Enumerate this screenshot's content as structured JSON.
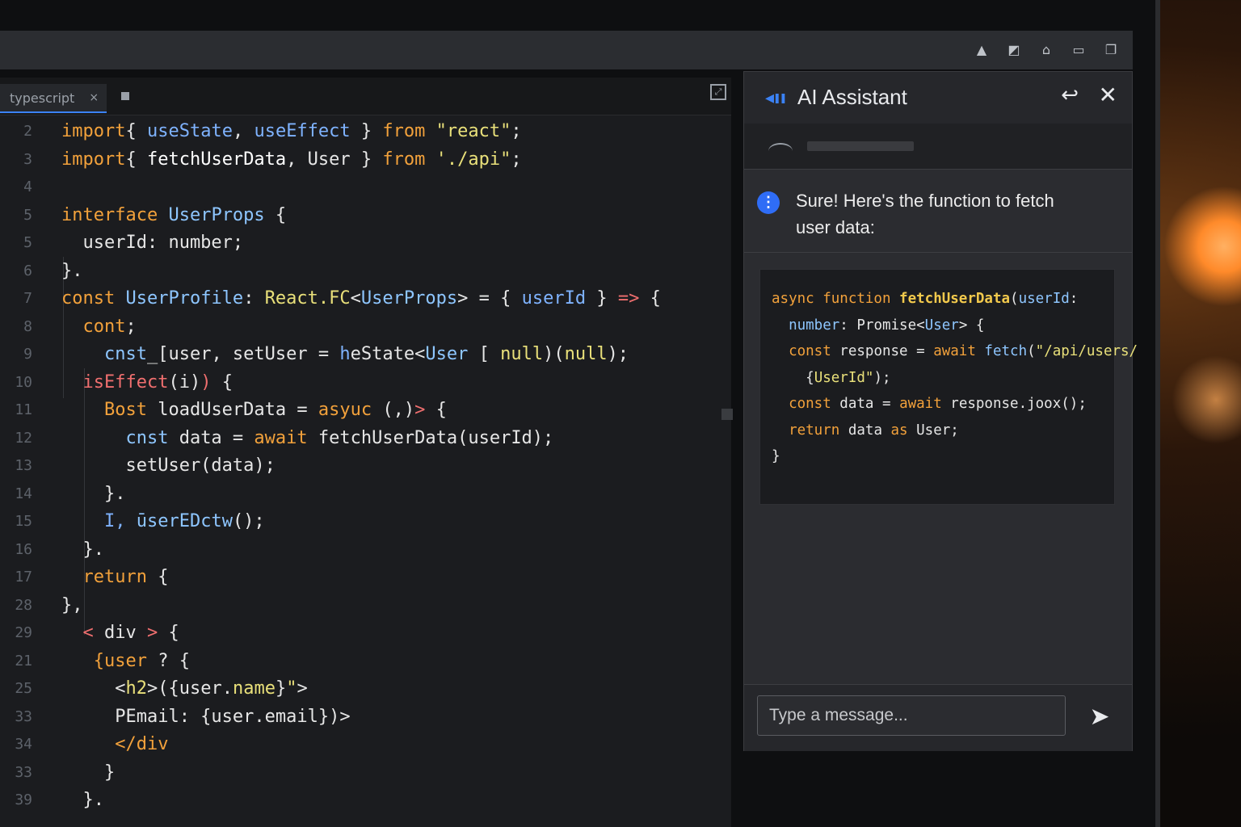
{
  "toolbar_icons": [
    "notification-icon",
    "edit-icon",
    "cloud-icon",
    "window-icon",
    "copy-icon"
  ],
  "editor": {
    "tab_label": "typescript",
    "tab_close": "×",
    "line_numbers": [
      "2",
      "3",
      "4",
      "5",
      "5",
      "6",
      "7",
      "8",
      "9",
      "10",
      "11",
      "12",
      "13",
      "14",
      "15",
      "16",
      "17",
      "28",
      "29",
      "21",
      "25",
      "33",
      "34",
      "33",
      "39"
    ],
    "code_lines": [
      [
        [
          "kw",
          "import"
        ],
        [
          "",
          "{ "
        ],
        [
          "vb",
          "useState"
        ],
        [
          "",
          ", "
        ],
        [
          "vb",
          "useEffect"
        ],
        [
          "",
          " } "
        ],
        [
          "kw",
          "from"
        ],
        [
          "str",
          " \"react\""
        ],
        [
          "",
          ";"
        ]
      ],
      [
        [
          "kw",
          "import"
        ],
        [
          "",
          "{ "
        ],
        [
          "fn",
          "fetchUserData"
        ],
        [
          "",
          ", User } "
        ],
        [
          "kw",
          "from"
        ],
        [
          "str",
          " './api\""
        ],
        [
          "",
          ";"
        ]
      ],
      [
        [
          "",
          ""
        ]
      ],
      [
        [
          "kw",
          "interface"
        ],
        [
          "ty",
          " UserProps"
        ],
        [
          "",
          " {"
        ]
      ],
      [
        [
          "",
          "  userId: number;"
        ]
      ],
      [
        [
          "",
          "}."
        ]
      ],
      [
        [
          "kw",
          "const"
        ],
        [
          "ty",
          " UserProfile"
        ],
        [
          "",
          ": "
        ],
        [
          "str",
          "React.FC"
        ],
        [
          "",
          "<"
        ],
        [
          "ty",
          "UserProps"
        ],
        [
          "",
          "> = { "
        ],
        [
          "vb",
          "userId"
        ],
        [
          "",
          " } "
        ],
        [
          "ln",
          "=>"
        ],
        [
          "",
          " {"
        ]
      ],
      [
        [
          "kw",
          "  cont"
        ],
        [
          "",
          ";"
        ]
      ],
      [
        [
          "ty",
          "    cnst"
        ],
        [
          "",
          "_[user, setUser = "
        ],
        [
          "vb",
          "h"
        ],
        [
          "",
          "eState<"
        ],
        [
          "ty",
          "User"
        ],
        [
          "",
          " [ "
        ],
        [
          "str",
          "null"
        ],
        [
          "",
          ")("
        ],
        [
          "str",
          "null"
        ],
        [
          "",
          ");"
        ]
      ],
      [
        [
          "ln",
          "  isEffect"
        ],
        [
          "",
          "(i)"
        ],
        [
          "ln",
          ")"
        ],
        [
          "",
          " {"
        ]
      ],
      [
        [
          "kw",
          "    Bost"
        ],
        [
          "",
          " loadUserData = "
        ],
        [
          "kw",
          "asyuc"
        ],
        [
          "",
          " (,)"
        ],
        [
          "ln",
          "> "
        ],
        [
          "",
          "{"
        ]
      ],
      [
        [
          "ty",
          "      cnst"
        ],
        [
          "",
          " data = "
        ],
        [
          "kw",
          "await"
        ],
        [
          "",
          " fetchUserData(userId);"
        ]
      ],
      [
        [
          "",
          "      setUser(data);"
        ]
      ],
      [
        [
          "",
          "    }."
        ]
      ],
      [
        [
          "vb",
          "    I,"
        ],
        [
          "ty",
          " ūserEDctw"
        ],
        [
          "",
          "();"
        ]
      ],
      [
        [
          "",
          "  }."
        ]
      ],
      [
        [
          "kw",
          "  return"
        ],
        [
          "",
          " {"
        ]
      ],
      [
        [
          "",
          "},"
        ]
      ],
      [
        [
          "ln",
          "  < "
        ],
        [
          "",
          "div "
        ],
        [
          "ln",
          "> "
        ],
        [
          "",
          "{"
        ]
      ],
      [
        [
          "kw",
          "   {user"
        ],
        [
          "",
          " ? {"
        ]
      ],
      [
        [
          "",
          "     <"
        ],
        [
          "str",
          "h2"
        ],
        [
          "",
          ">({user."
        ],
        [
          "str",
          "name"
        ],
        [
          "",
          "}"
        ],
        [
          "str",
          "\""
        ],
        [
          "",
          ">"
        ]
      ],
      [
        [
          "",
          "     PEmail: {user.email})>"
        ]
      ],
      [
        [
          "kw",
          "     </div"
        ]
      ],
      [
        [
          "",
          "    }"
        ]
      ],
      [
        [
          "",
          "  }."
        ]
      ]
    ]
  },
  "assistant": {
    "title": "AI Assistant",
    "back_icon": "reply-icon",
    "close_icon": "close-icon",
    "bot_avatar_glyph": "⋮",
    "message": "Sure! Here's the function to fetch user data:",
    "code_lines": [
      [
        [
          "cb-kw",
          "async function "
        ],
        [
          "cb-fn",
          "fetchUserData"
        ],
        [
          "",
          "("
        ],
        [
          "cb-ty",
          "userId"
        ],
        [
          "",
          ":"
        ]
      ],
      [
        [
          "cb-ty",
          "  number"
        ],
        [
          "",
          ": Promise<"
        ],
        [
          "cb-ty",
          "User"
        ],
        [
          "",
          "> {"
        ]
      ],
      [
        [
          "",
          ""
        ]
      ],
      [
        [
          "cb-kw",
          "  const"
        ],
        [
          "",
          " response = "
        ],
        [
          "cb-kw",
          "await"
        ],
        [
          "cb-ty",
          " fetch"
        ],
        [
          "",
          "("
        ],
        [
          "cb-str",
          "\"/api/users/"
        ]
      ],
      [
        [
          "",
          "    {"
        ],
        [
          "cb-str",
          "UserId\""
        ],
        [
          "",
          ");"
        ]
      ],
      [
        [
          "cb-kw",
          "  const"
        ],
        [
          "",
          " data = "
        ],
        [
          "cb-kw",
          "await"
        ],
        [
          "",
          " response.joox();"
        ]
      ],
      [
        [
          "cb-kw",
          "  return"
        ],
        [
          "",
          " data "
        ],
        [
          "cb-kw",
          "as"
        ],
        [
          "",
          " User;"
        ]
      ],
      [
        [
          "",
          "}"
        ]
      ]
    ],
    "input_placeholder": "Type a message...",
    "send_icon": "send-icon"
  }
}
